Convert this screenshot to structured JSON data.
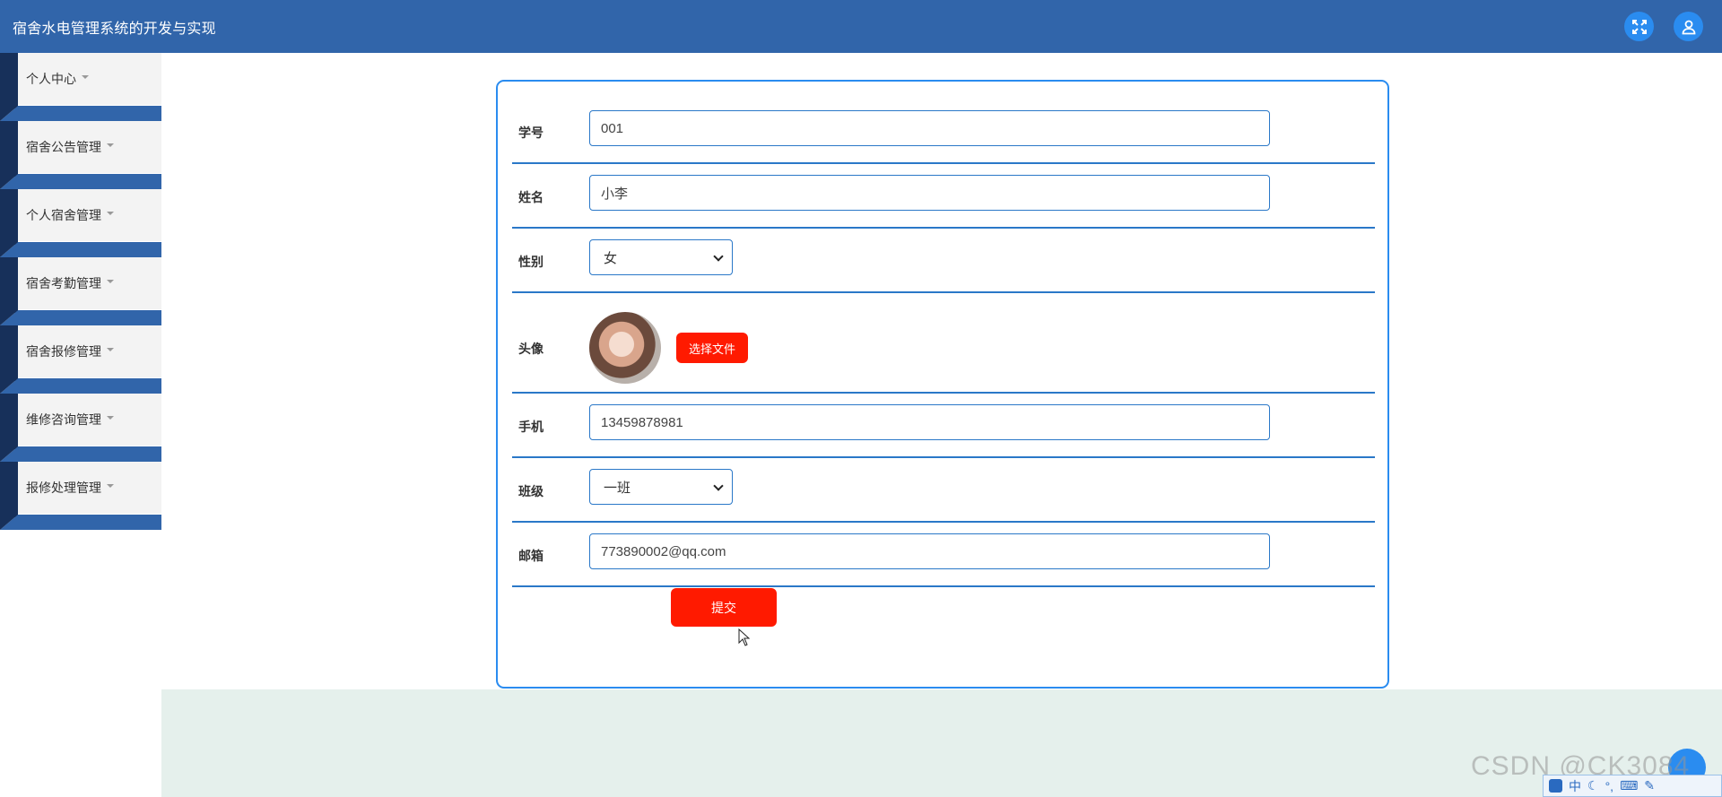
{
  "header": {
    "title": "宿舍水电管理系统的开发与实现",
    "icons": [
      "fullscreen-icon",
      "user-icon"
    ]
  },
  "sidebar": {
    "items": [
      {
        "label": "个人中心"
      },
      {
        "label": "宿舍公告管理"
      },
      {
        "label": "个人宿舍管理"
      },
      {
        "label": "宿舍考勤管理"
      },
      {
        "label": "宿舍报修管理"
      },
      {
        "label": "维修咨询管理"
      },
      {
        "label": "报修处理管理"
      }
    ]
  },
  "form": {
    "student_id": {
      "label": "学号",
      "value": "001"
    },
    "name": {
      "label": "姓名",
      "value": "小李"
    },
    "gender": {
      "label": "性别",
      "value": "女"
    },
    "avatar": {
      "label": "头像",
      "button": "选择文件"
    },
    "phone": {
      "label": "手机",
      "value": "13459878981"
    },
    "class": {
      "label": "班级",
      "value": "一班"
    },
    "email": {
      "label": "邮箱",
      "value": "773890002@qq.com"
    },
    "submit": "提交"
  },
  "watermark": "CSDN @CK3084",
  "ime": {
    "mode": "中"
  },
  "colors": {
    "header": "#3165aa",
    "accent": "#2a8cf0",
    "danger_button": "#ff1a00",
    "sidebar_dark": "#17305a",
    "bottom_panel": "#e5f0ec"
  }
}
